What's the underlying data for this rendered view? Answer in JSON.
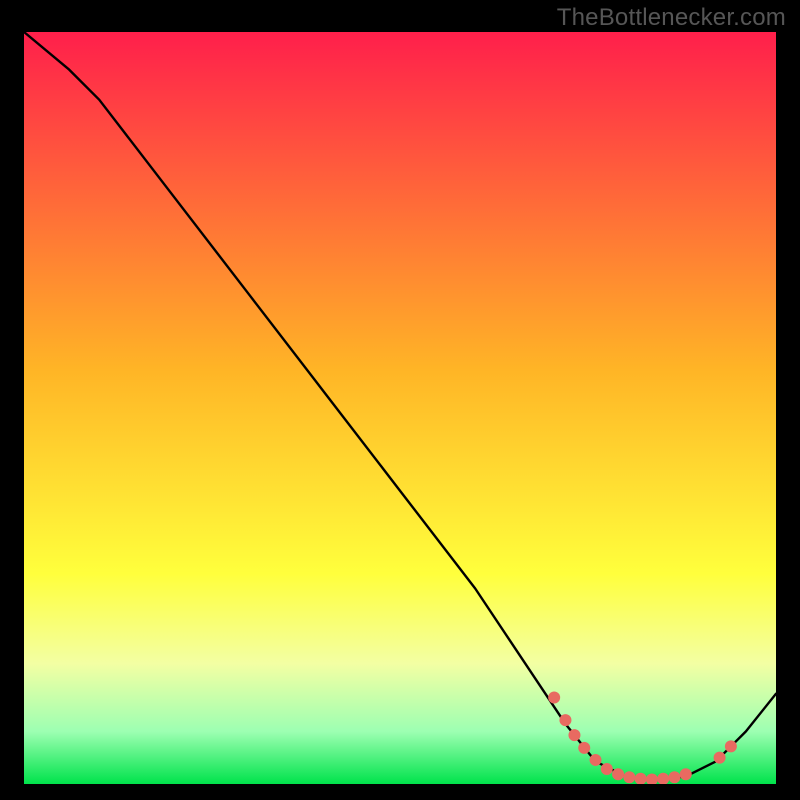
{
  "watermark": "TheBottlenecker.com",
  "chart_data": {
    "type": "line",
    "title": "",
    "xlabel": "",
    "ylabel": "",
    "xlim": [
      0,
      100
    ],
    "ylim": [
      0,
      100
    ],
    "grid": false,
    "legend": false,
    "gradient_stops": [
      {
        "offset": 0.0,
        "color": "#ff1f4b"
      },
      {
        "offset": 0.45,
        "color": "#ffb526"
      },
      {
        "offset": 0.72,
        "color": "#ffff3c"
      },
      {
        "offset": 0.84,
        "color": "#f3ffa3"
      },
      {
        "offset": 0.93,
        "color": "#9dffb2"
      },
      {
        "offset": 1.0,
        "color": "#00e34b"
      }
    ],
    "curve_points": [
      {
        "x": 0,
        "y": 100
      },
      {
        "x": 6,
        "y": 95
      },
      {
        "x": 10,
        "y": 91
      },
      {
        "x": 20,
        "y": 78
      },
      {
        "x": 30,
        "y": 65
      },
      {
        "x": 40,
        "y": 52
      },
      {
        "x": 50,
        "y": 39
      },
      {
        "x": 60,
        "y": 26
      },
      {
        "x": 68,
        "y": 14
      },
      {
        "x": 72,
        "y": 8
      },
      {
        "x": 76,
        "y": 3
      },
      {
        "x": 80,
        "y": 1
      },
      {
        "x": 84,
        "y": 0.5
      },
      {
        "x": 88,
        "y": 1
      },
      {
        "x": 92,
        "y": 3
      },
      {
        "x": 96,
        "y": 7
      },
      {
        "x": 100,
        "y": 12
      }
    ],
    "dot_points": [
      {
        "x": 70.5,
        "y": 11.5
      },
      {
        "x": 72.0,
        "y": 8.5
      },
      {
        "x": 73.2,
        "y": 6.5
      },
      {
        "x": 74.5,
        "y": 4.8
      },
      {
        "x": 76.0,
        "y": 3.2
      },
      {
        "x": 77.5,
        "y": 2.0
      },
      {
        "x": 79.0,
        "y": 1.3
      },
      {
        "x": 80.5,
        "y": 0.9
      },
      {
        "x": 82.0,
        "y": 0.7
      },
      {
        "x": 83.5,
        "y": 0.6
      },
      {
        "x": 85.0,
        "y": 0.7
      },
      {
        "x": 86.5,
        "y": 0.9
      },
      {
        "x": 88.0,
        "y": 1.3
      },
      {
        "x": 92.5,
        "y": 3.5
      },
      {
        "x": 94.0,
        "y": 5.0
      }
    ],
    "dot_color": "#e86a61",
    "curve_color": "#000000"
  }
}
